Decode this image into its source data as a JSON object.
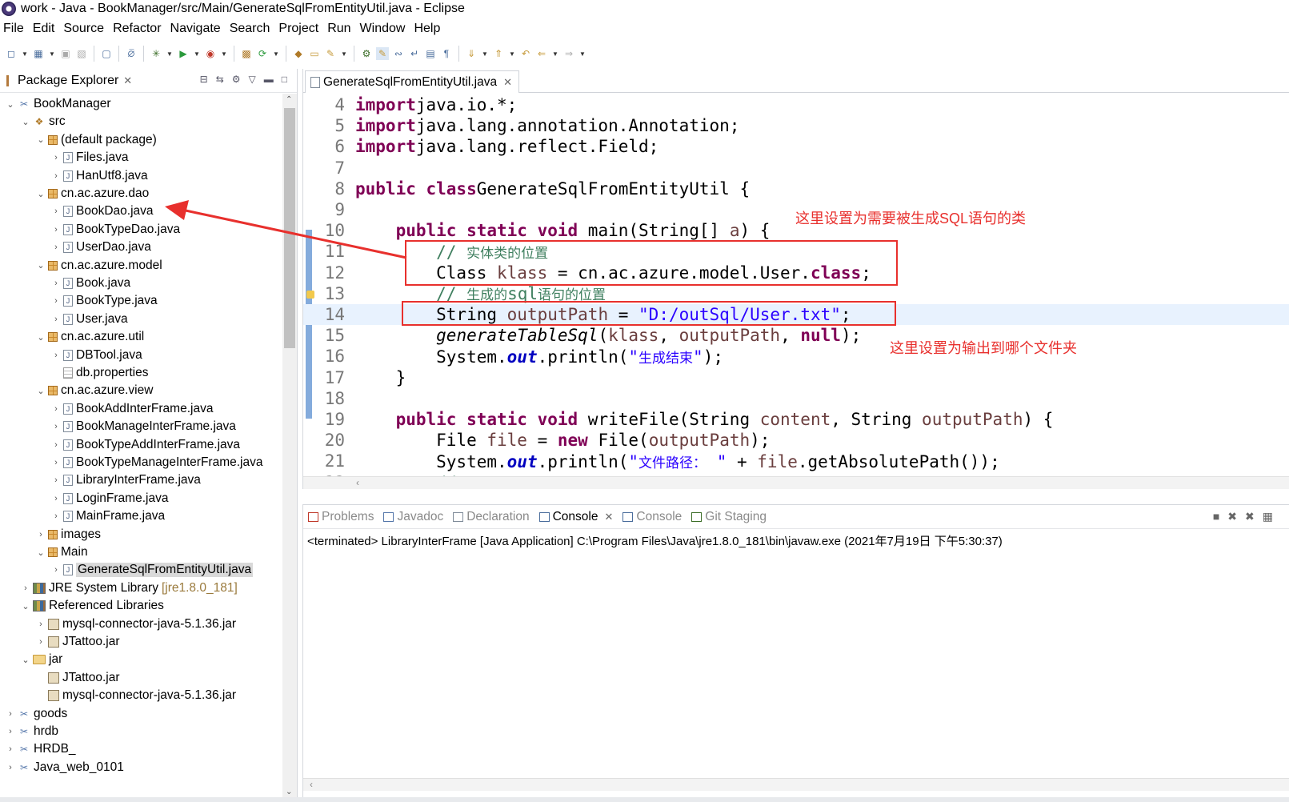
{
  "window": {
    "title": "work - Java - BookManager/src/Main/GenerateSqlFromEntityUtil.java - Eclipse"
  },
  "menu": [
    "File",
    "Edit",
    "Source",
    "Refactor",
    "Navigate",
    "Search",
    "Project",
    "Run",
    "Window",
    "Help"
  ],
  "package_explorer": {
    "title": "Package Explorer",
    "tree": [
      {
        "label": "BookManager",
        "icon": "project-icon",
        "expanded": true,
        "depth": 0
      },
      {
        "label": "src",
        "icon": "source-folder-icon",
        "expanded": true,
        "depth": 1
      },
      {
        "label": "(default package)",
        "icon": "package-icon",
        "expanded": true,
        "depth": 2
      },
      {
        "label": "Files.java",
        "icon": "java-file-icon",
        "depth": 3
      },
      {
        "label": "HanUtf8.java",
        "icon": "java-file-icon",
        "depth": 3
      },
      {
        "label": "cn.ac.azure.dao",
        "icon": "package-icon",
        "expanded": true,
        "depth": 2
      },
      {
        "label": "BookDao.java",
        "icon": "java-file-icon",
        "depth": 3
      },
      {
        "label": "BookTypeDao.java",
        "icon": "java-file-icon",
        "depth": 3
      },
      {
        "label": "UserDao.java",
        "icon": "java-file-icon",
        "depth": 3
      },
      {
        "label": "cn.ac.azure.model",
        "icon": "package-icon",
        "expanded": true,
        "depth": 2
      },
      {
        "label": "Book.java",
        "icon": "java-file-icon",
        "depth": 3
      },
      {
        "label": "BookType.java",
        "icon": "java-file-icon",
        "depth": 3
      },
      {
        "label": "User.java",
        "icon": "java-file-icon",
        "depth": 3
      },
      {
        "label": "cn.ac.azure.util",
        "icon": "package-icon",
        "expanded": true,
        "depth": 2
      },
      {
        "label": "DBTool.java",
        "icon": "java-file-icon",
        "depth": 3
      },
      {
        "label": "db.properties",
        "icon": "properties-file-icon",
        "depth": 3,
        "leaf": true
      },
      {
        "label": "cn.ac.azure.view",
        "icon": "package-icon",
        "expanded": true,
        "depth": 2
      },
      {
        "label": "BookAddInterFrame.java",
        "icon": "java-file-icon",
        "depth": 3
      },
      {
        "label": "BookManageInterFrame.java",
        "icon": "java-file-icon",
        "depth": 3
      },
      {
        "label": "BookTypeAddInterFrame.java",
        "icon": "java-file-icon",
        "depth": 3
      },
      {
        "label": "BookTypeManageInterFrame.java",
        "icon": "java-file-icon",
        "depth": 3
      },
      {
        "label": "LibraryInterFrame.java",
        "icon": "java-file-icon",
        "depth": 3
      },
      {
        "label": "LoginFrame.java",
        "icon": "java-file-icon",
        "depth": 3
      },
      {
        "label": "MainFrame.java",
        "icon": "java-file-icon",
        "depth": 3
      },
      {
        "label": "images",
        "icon": "package-icon",
        "expanded": false,
        "depth": 2
      },
      {
        "label": "Main",
        "icon": "package-icon",
        "expanded": true,
        "depth": 2
      },
      {
        "label": "GenerateSqlFromEntityUtil.java",
        "icon": "java-file-icon",
        "depth": 3,
        "selected": true
      },
      {
        "label": "JRE System Library",
        "suffix": "[jre1.8.0_181]",
        "icon": "library-icon",
        "expanded": false,
        "depth": 1
      },
      {
        "label": "Referenced Libraries",
        "icon": "library-icon",
        "expanded": true,
        "depth": 1
      },
      {
        "label": "mysql-connector-java-5.1.36.jar",
        "icon": "jar-icon",
        "expanded": false,
        "depth": 2
      },
      {
        "label": "JTattoo.jar",
        "icon": "jar-icon",
        "expanded": false,
        "depth": 2
      },
      {
        "label": "jar",
        "icon": "folder-icon",
        "expanded": true,
        "depth": 1
      },
      {
        "label": "JTattoo.jar",
        "icon": "jar-icon",
        "depth": 2,
        "leaf": true
      },
      {
        "label": "mysql-connector-java-5.1.36.jar",
        "icon": "jar-icon",
        "depth": 2,
        "leaf": true
      },
      {
        "label": "goods",
        "icon": "project-icon",
        "expanded": false,
        "depth": 0
      },
      {
        "label": "hrdb",
        "icon": "project-icon",
        "expanded": false,
        "depth": 0
      },
      {
        "label": "HRDB_",
        "icon": "project-icon",
        "expanded": false,
        "depth": 0
      },
      {
        "label": "Java_web_0101",
        "icon": "project-icon",
        "expanded": false,
        "depth": 0
      }
    ]
  },
  "editor": {
    "tab_label": "GenerateSqlFromEntityUtil.java",
    "lines": [
      {
        "n": "4",
        "tokens": [
          [
            "kw",
            "import"
          ],
          [
            "",
            "java.io.*;"
          ]
        ]
      },
      {
        "n": "5",
        "tokens": [
          [
            "kw",
            "import"
          ],
          [
            "",
            "java.lang.annotation.Annotation;"
          ]
        ]
      },
      {
        "n": "6",
        "tokens": [
          [
            "kw",
            "import"
          ],
          [
            "",
            "java.lang.reflect.Field;"
          ]
        ]
      },
      {
        "n": "7",
        "tokens": []
      },
      {
        "n": "8",
        "tokens": [
          [
            "kw",
            "public"
          ],
          [
            "kw",
            " class"
          ],
          [
            "",
            "GenerateSqlFromEntityUtil {"
          ]
        ]
      },
      {
        "n": "9",
        "tokens": []
      },
      {
        "n": "10",
        "tokens": [
          [
            "",
            "    "
          ],
          [
            "kw",
            "public static void"
          ],
          [
            "",
            " main(String[] "
          ],
          [
            "var",
            "a"
          ],
          [
            "",
            ") {"
          ]
        ]
      },
      {
        "n": "11",
        "tokens": [
          [
            "",
            "        "
          ],
          [
            "cmt",
            "// "
          ],
          [
            "cmt cjk",
            "实体类的位置"
          ]
        ]
      },
      {
        "n": "12",
        "tokens": [
          [
            "",
            "        Class "
          ],
          [
            "var",
            "klass"
          ],
          [
            "",
            " = cn.ac.azure.model.User."
          ],
          [
            "kw",
            "class"
          ],
          [
            "",
            ";"
          ]
        ]
      },
      {
        "n": "13",
        "tokens": [
          [
            "",
            "        "
          ],
          [
            "cmt",
            "// "
          ],
          [
            "cmt cjk",
            "生成的"
          ],
          [
            "cmt",
            "sql"
          ],
          [
            "cmt cjk",
            "语句的位置"
          ]
        ]
      },
      {
        "n": "14",
        "tokens": [
          [
            "",
            "        String "
          ],
          [
            "var",
            "outputPath"
          ],
          [
            "",
            " = "
          ],
          [
            "str",
            "\"D:/outSql/User.txt\""
          ],
          [
            "",
            ";"
          ]
        ],
        "highlight": true
      },
      {
        "n": "15",
        "tokens": [
          [
            "",
            "        "
          ],
          [
            "it",
            "generateTableSql"
          ],
          [
            "",
            "("
          ],
          [
            "var",
            "klass"
          ],
          [
            "",
            ", "
          ],
          [
            "var",
            "outputPath"
          ],
          [
            "",
            ", "
          ],
          [
            "kw",
            "null"
          ],
          [
            "",
            ");"
          ]
        ]
      },
      {
        "n": "16",
        "tokens": [
          [
            "",
            "        System."
          ],
          [
            "fld",
            "out"
          ],
          [
            "",
            ".println("
          ],
          [
            "str",
            "\""
          ],
          [
            "str cjk",
            "生成结束"
          ],
          [
            "str",
            "\""
          ],
          [
            "",
            ");"
          ]
        ]
      },
      {
        "n": "17",
        "tokens": [
          [
            "",
            "    }"
          ]
        ]
      },
      {
        "n": "18",
        "tokens": []
      },
      {
        "n": "19",
        "tokens": [
          [
            "",
            "    "
          ],
          [
            "kw",
            "public static void"
          ],
          [
            "",
            " writeFile(String "
          ],
          [
            "var",
            "content"
          ],
          [
            "",
            ", String "
          ],
          [
            "var",
            "outputPath"
          ],
          [
            "",
            ") {"
          ]
        ]
      },
      {
        "n": "20",
        "tokens": [
          [
            "",
            "        File "
          ],
          [
            "var",
            "file"
          ],
          [
            "",
            " = "
          ],
          [
            "kw",
            "new"
          ],
          [
            "",
            " File("
          ],
          [
            "var",
            "outputPath"
          ],
          [
            "",
            ");"
          ]
        ]
      },
      {
        "n": "21",
        "tokens": [
          [
            "",
            "        System."
          ],
          [
            "fld",
            "out"
          ],
          [
            "",
            ".println("
          ],
          [
            "str",
            "\""
          ],
          [
            "str cjk",
            "文件路径："
          ],
          [
            "str",
            " \""
          ],
          [
            "",
            " + "
          ],
          [
            "var",
            "file"
          ],
          [
            "",
            ".getAbsolutePath());"
          ]
        ]
      },
      {
        "n": "22",
        "tokens": [
          [
            "",
            "        "
          ],
          [
            "cmt",
            "// "
          ],
          [
            "cmt cjk",
            "输出文件的路径"
          ]
        ]
      }
    ]
  },
  "annotations": {
    "note_class": "这里设置为需要被生成SQL语句的类",
    "note_output": "这里设置为输出到哪个文件夹"
  },
  "console_panel": {
    "tabs": [
      {
        "label": "Problems",
        "icon": "problems-icon",
        "active": false
      },
      {
        "label": "Javadoc",
        "icon": "javadoc-icon",
        "active": false
      },
      {
        "label": "Declaration",
        "icon": "declaration-icon",
        "active": false
      },
      {
        "label": "Console",
        "icon": "console-icon",
        "active": true
      },
      {
        "label": "Console",
        "icon": "console-icon",
        "active": false
      },
      {
        "label": "Git Staging",
        "icon": "git-staging-icon",
        "active": false
      }
    ],
    "status": "<terminated> LibraryInterFrame [Java Application] C:\\Program Files\\Java\\jre1.8.0_181\\bin\\javaw.exe (2021年7月19日 下午5:30:37)"
  }
}
